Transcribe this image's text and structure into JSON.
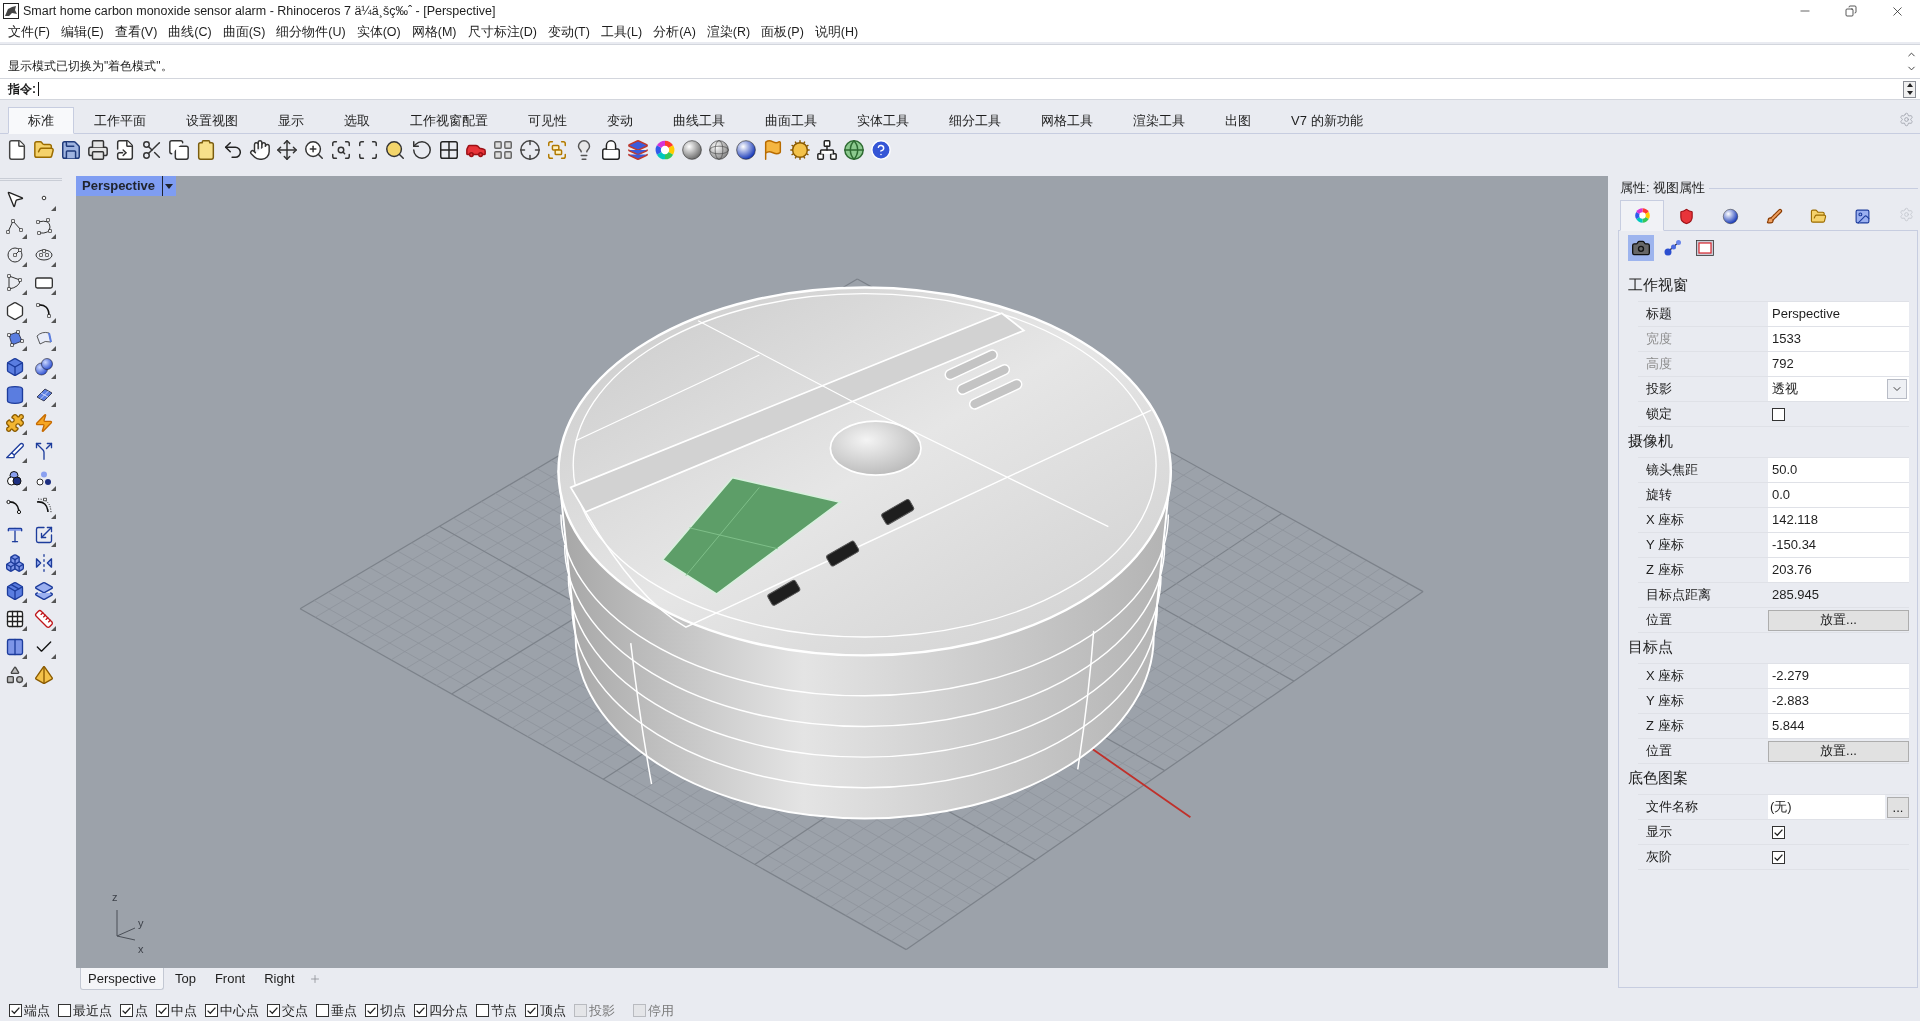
{
  "window": {
    "title": "Smart home carbon monoxide sensor alarm - Rhinoceros 7 ä¼ä¸šç‰ˆ - [Perspective]"
  },
  "menu": [
    "文件(F)",
    "编辑(E)",
    "查看(V)",
    "曲线(C)",
    "曲面(S)",
    "细分物件(U)",
    "实体(O)",
    "网格(M)",
    "尺寸标注(D)",
    "变动(T)",
    "工具(L)",
    "分析(A)",
    "渲染(R)",
    "面板(P)",
    "说明(H)"
  ],
  "command": {
    "history": [
      "显示模式已切换为\"着色模式\"。"
    ],
    "prompt": "指令:"
  },
  "toolbar_tabs": [
    {
      "label": "标准",
      "selected": true
    },
    {
      "label": "工作平面",
      "selected": false
    },
    {
      "label": "设置视图",
      "selected": false
    },
    {
      "label": "显示",
      "selected": false
    },
    {
      "label": "选取",
      "selected": false
    },
    {
      "label": "工作视窗配置",
      "selected": false
    },
    {
      "label": "可见性",
      "selected": false
    },
    {
      "label": "变动",
      "selected": false
    },
    {
      "label": "曲线工具",
      "selected": false
    },
    {
      "label": "曲面工具",
      "selected": false
    },
    {
      "label": "实体工具",
      "selected": false
    },
    {
      "label": "细分工具",
      "selected": false
    },
    {
      "label": "网格工具",
      "selected": false
    },
    {
      "label": "渲染工具",
      "selected": false
    },
    {
      "label": "出图",
      "selected": false
    },
    {
      "label": "V7 的新功能",
      "selected": false
    }
  ],
  "viewport": {
    "title": "Perspective",
    "axis_labels": [
      "z",
      "y",
      "x"
    ],
    "tabs": [
      {
        "label": "Perspective",
        "selected": true
      },
      {
        "label": "Top",
        "selected": false
      },
      {
        "label": "Front",
        "selected": false
      },
      {
        "label": "Right",
        "selected": false
      }
    ]
  },
  "properties": {
    "title": "属性: 视图属性",
    "tabs": [
      {
        "selected": true
      },
      {
        "selected": false
      },
      {
        "selected": false
      },
      {
        "selected": false
      },
      {
        "selected": false
      },
      {
        "selected": false
      }
    ],
    "sub_tabs": [
      {
        "selected": true
      },
      {
        "selected": false
      },
      {
        "selected": false
      }
    ],
    "sections": [
      {
        "title": "工作视窗",
        "rows": [
          {
            "label": "标题",
            "kind": "text",
            "value": "Perspective",
            "disabled": false
          },
          {
            "label": "宽度",
            "kind": "text",
            "value": "1533",
            "disabled": true
          },
          {
            "label": "高度",
            "kind": "text",
            "value": "792",
            "disabled": true
          },
          {
            "label": "投影",
            "kind": "dropdown",
            "value": "透视",
            "disabled": false
          },
          {
            "label": "锁定",
            "kind": "checkbox",
            "checked": false,
            "disabled": false
          }
        ]
      },
      {
        "title": "摄像机",
        "rows": [
          {
            "label": "镜头焦距",
            "kind": "text",
            "value": "50.0",
            "disabled": false
          },
          {
            "label": "旋转",
            "kind": "text",
            "value": "0.0",
            "disabled": false
          },
          {
            "label": "X 座标",
            "kind": "text",
            "value": "142.118",
            "disabled": false
          },
          {
            "label": "Y 座标",
            "kind": "text",
            "value": "-150.34",
            "disabled": false
          },
          {
            "label": "Z 座标",
            "kind": "text",
            "value": "203.76",
            "disabled": false
          },
          {
            "label": "目标点距离",
            "kind": "readonly",
            "value": "285.945",
            "disabled": false
          },
          {
            "label": "位置",
            "kind": "button",
            "value": "放置...",
            "disabled": false
          }
        ]
      },
      {
        "title": "目标点",
        "rows": [
          {
            "label": "X 座标",
            "kind": "text",
            "value": "-2.279",
            "disabled": false
          },
          {
            "label": "Y 座标",
            "kind": "text",
            "value": "-2.883",
            "disabled": false
          },
          {
            "label": "Z 座标",
            "kind": "text",
            "value": "5.844",
            "disabled": false
          },
          {
            "label": "位置",
            "kind": "button",
            "value": "放置...",
            "disabled": false
          }
        ]
      },
      {
        "title": "底色图案",
        "rows": [
          {
            "label": "文件名称",
            "kind": "file",
            "value": "(无)",
            "button": "...",
            "disabled": false
          },
          {
            "label": "显示",
            "kind": "checkbox",
            "checked": true,
            "disabled": false
          },
          {
            "label": "灰阶",
            "kind": "checkbox",
            "checked": true,
            "disabled": false
          }
        ]
      }
    ]
  },
  "osnap": {
    "items": [
      {
        "label": "端点",
        "checked": true,
        "disabled": false
      },
      {
        "label": "最近点",
        "checked": false,
        "disabled": false
      },
      {
        "label": "点",
        "checked": true,
        "disabled": false
      },
      {
        "label": "中点",
        "checked": true,
        "disabled": false
      },
      {
        "label": "中心点",
        "checked": true,
        "disabled": false
      },
      {
        "label": "交点",
        "checked": true,
        "disabled": false
      },
      {
        "label": "垂点",
        "checked": false,
        "disabled": false
      },
      {
        "label": "切点",
        "checked": true,
        "disabled": false
      },
      {
        "label": "四分点",
        "checked": true,
        "disabled": false
      },
      {
        "label": "节点",
        "checked": false,
        "disabled": false
      },
      {
        "label": "顶点",
        "checked": true,
        "disabled": false
      },
      {
        "label": "投影",
        "checked": false,
        "disabled": true
      }
    ],
    "disable": {
      "label": "停用",
      "checked": false,
      "disabled": true
    }
  }
}
